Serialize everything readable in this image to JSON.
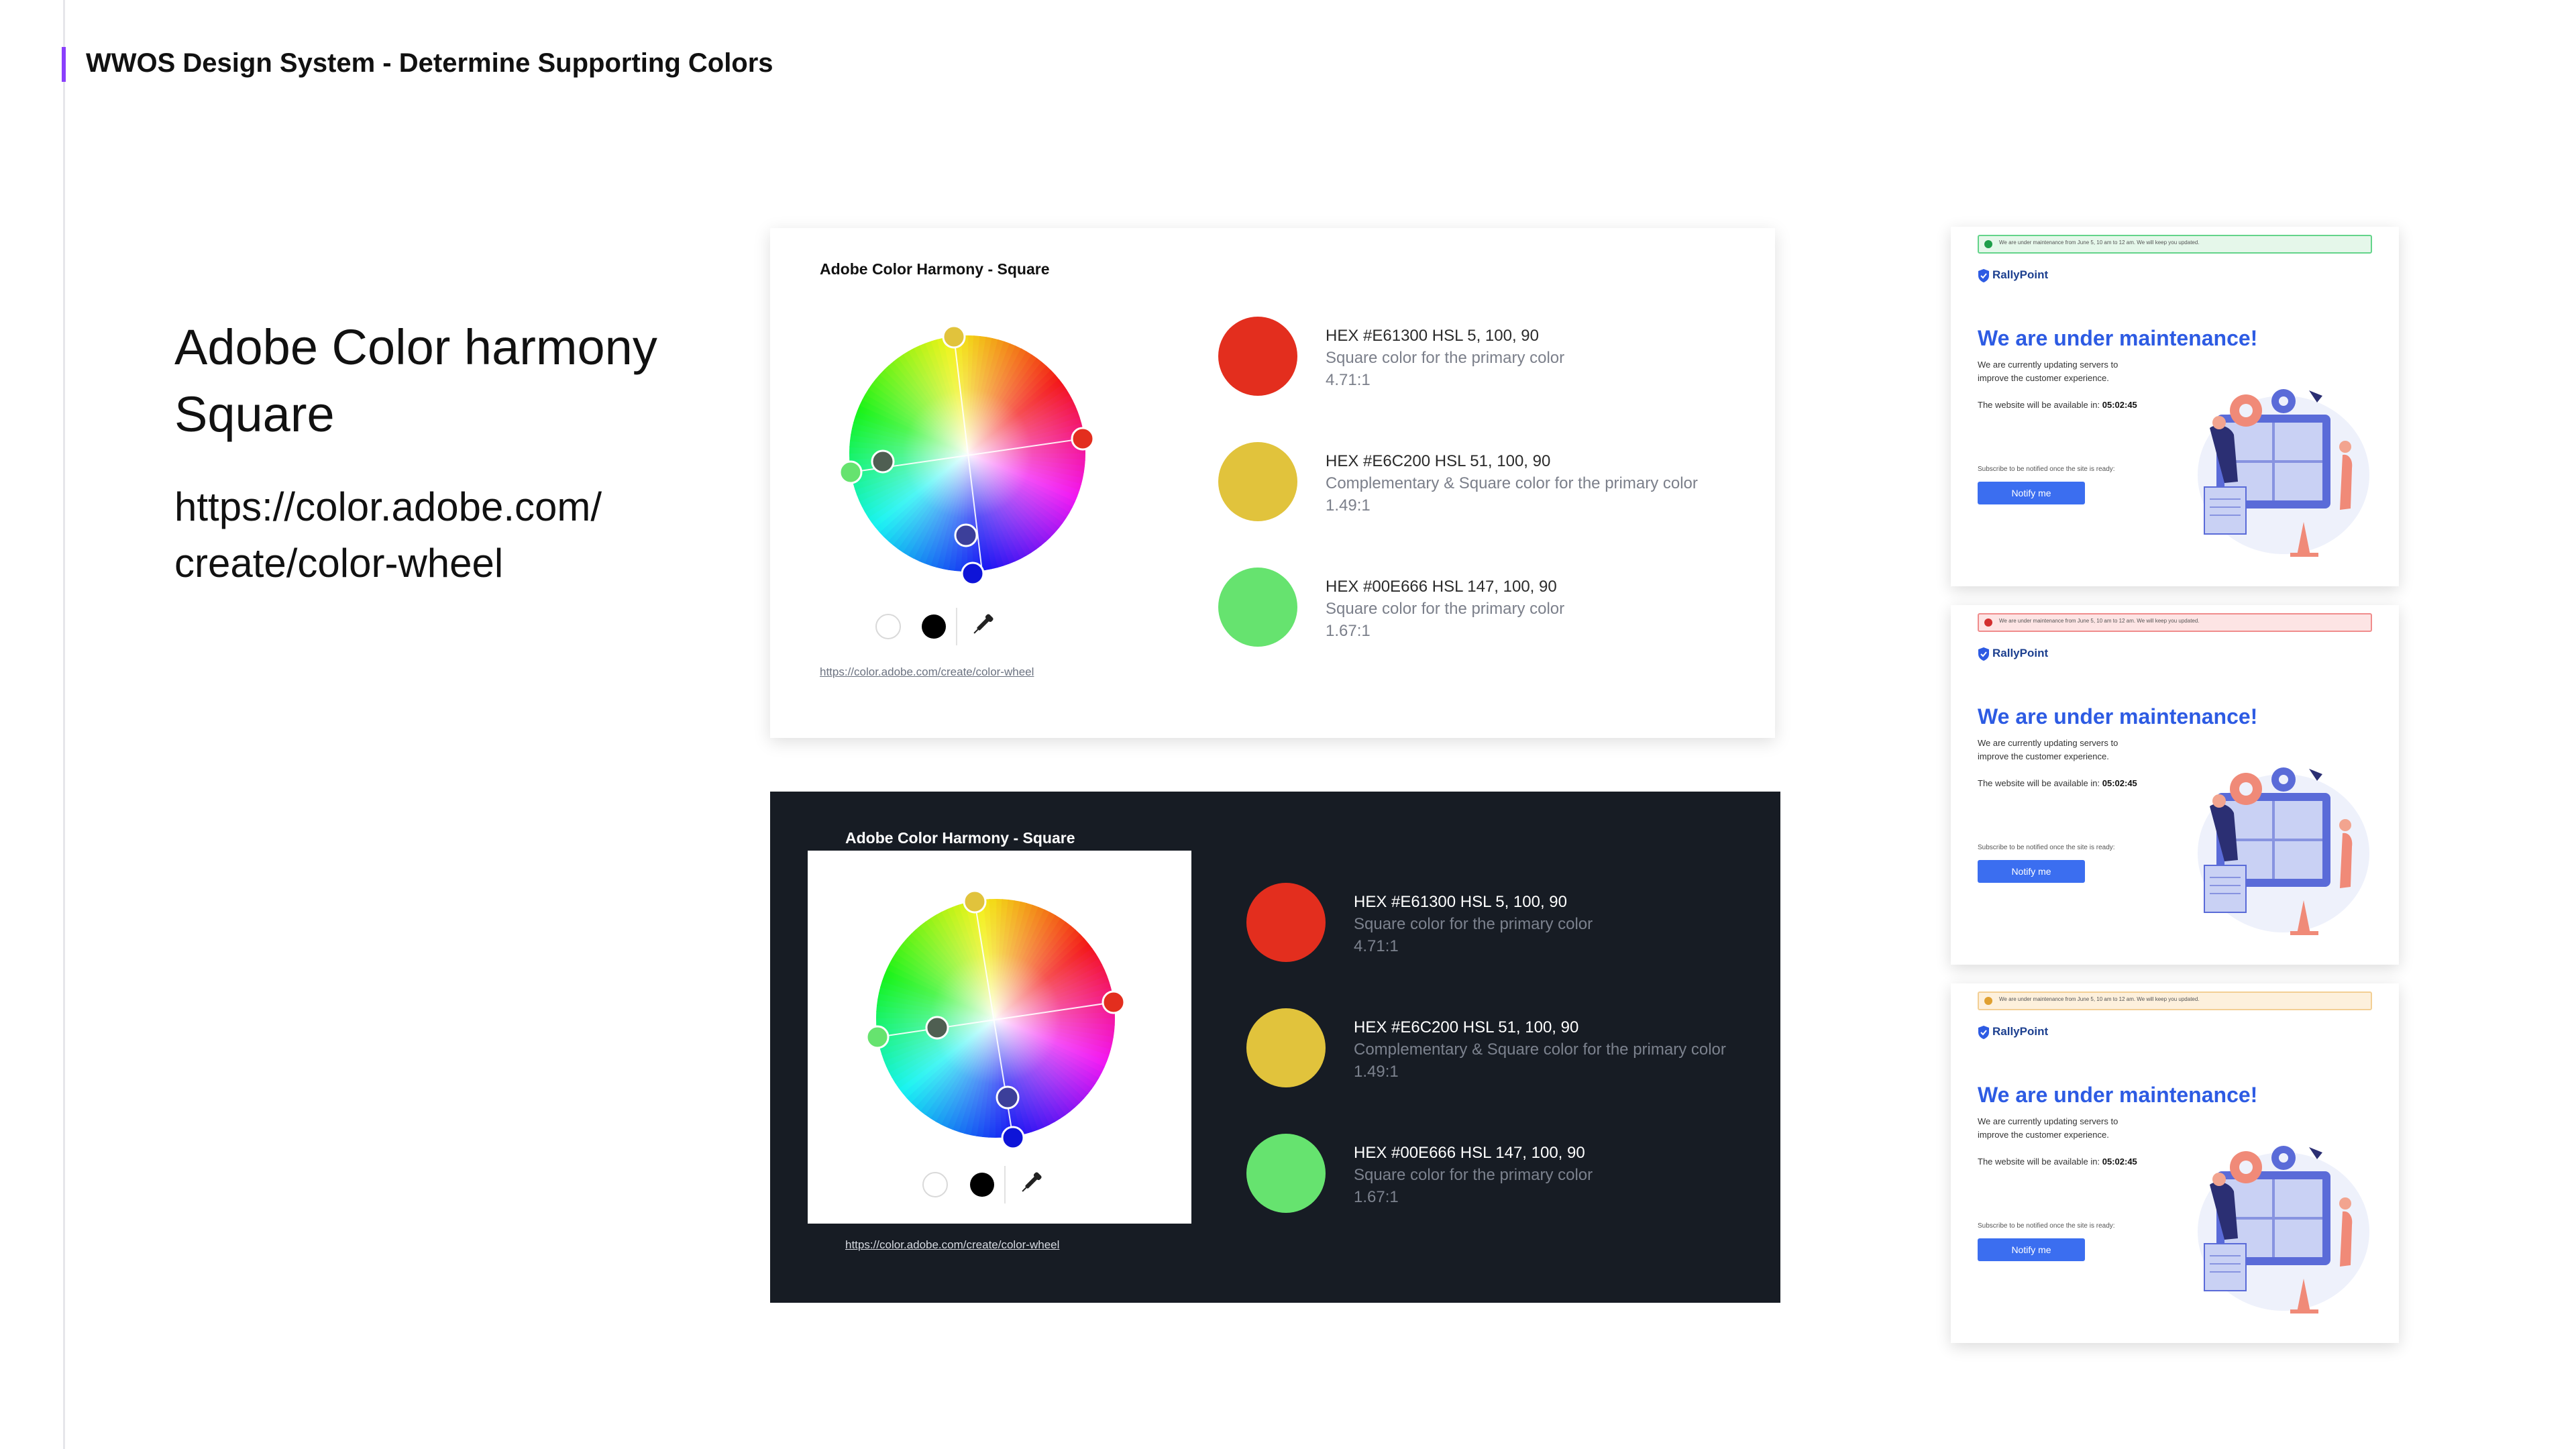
{
  "page": {
    "title": "WWOS Design System - Determine Supporting Colors"
  },
  "intro": {
    "heading_line1": "Adobe Color harmony",
    "heading_line2": "Square",
    "url_line1": "https://color.adobe.com/",
    "url_line2": "create/color-wheel"
  },
  "panels": [
    {
      "title": "Adobe Color Harmony - Square",
      "link": "https://color.adobe.com/create/color-wheel",
      "colors": [
        {
          "hex_line": "HEX #E61300 HSL 5, 100, 90",
          "role": "Square color for the primary color",
          "ratio": "4.71:1",
          "color": "#e32e1e"
        },
        {
          "hex_line": "HEX #E6C200 HSL 51, 100, 90",
          "role": "Complementary & Square color for the primary color",
          "ratio": "1.49:1",
          "color": "#e1c33c"
        },
        {
          "hex_line": "HEX #00E666 HSL 147, 100, 90",
          "role": "Square color for the primary color",
          "ratio": "1.67:1",
          "color": "#66e36f"
        }
      ]
    },
    {
      "title": "Adobe Color Harmony - Square",
      "link": "https://color.adobe.com/create/color-wheel",
      "colors": [
        {
          "hex_line": "HEX #E61300 HSL 5, 100, 90",
          "role": "Square color for the primary color",
          "ratio": "4.71:1",
          "color": "#e32e1e"
        },
        {
          "hex_line": "HEX #E6C200 HSL 51, 100, 90",
          "role": "Complementary & Square color for the primary color",
          "ratio": "1.49:1",
          "color": "#e1c33c"
        },
        {
          "hex_line": "HEX #00E666 HSL 147, 100, 90",
          "role": "Square color for the primary color",
          "ratio": "1.67:1",
          "color": "#66e36f"
        }
      ]
    }
  ],
  "wheel": {
    "handle_colors": [
      "#e1c33c",
      "#e32e1e",
      "#66e36f",
      "#3c3f9a",
      "#0e14d8",
      "#4a5a4a"
    ],
    "tools": [
      "white-swatch-icon",
      "black-swatch-icon",
      "eyedropper-icon"
    ]
  },
  "cards": [
    {
      "banner_text": "We are under maintenance from June 5, 10 am to 12 am. We will keep you updated.",
      "banner_bg": "#e5f7ea",
      "banner_border": "#63d48a",
      "banner_dot": "#1e9e4a",
      "brand": "RallyPoint",
      "heading": "We are under maintenance!",
      "body_line1": "We are currently updating servers to",
      "body_line2": "improve the customer experience.",
      "available_label": "The website will be available in:",
      "countdown": "05:02:45",
      "subscribe_text": "Subscribe to be notified once the site is ready:",
      "button_label": "Notify me"
    },
    {
      "banner_text": "We are under maintenance from June 5, 10 am to 12 am. We will keep you updated.",
      "banner_bg": "#fde4e4",
      "banner_border": "#f08c8c",
      "banner_dot": "#d32f2f",
      "brand": "RallyPoint",
      "heading": "We are under maintenance!",
      "body_line1": "We are currently updating servers to",
      "body_line2": "improve the customer experience.",
      "available_label": "The website will be available in:",
      "countdown": "05:02:45",
      "subscribe_text": "Subscribe to be notified once the site is ready:",
      "button_label": "Notify me"
    },
    {
      "banner_text": "We are under maintenance from June 5, 10 am to 12 am. We will keep you updated.",
      "banner_bg": "#fdf0dc",
      "banner_border": "#f3cf94",
      "banner_dot": "#e0a030",
      "brand": "RallyPoint",
      "heading": "We are under maintenance!",
      "body_line1": "We are currently updating servers to",
      "body_line2": "improve the customer experience.",
      "available_label": "The website will be available in:",
      "countdown": "05:02:45",
      "subscribe_text": "Subscribe to be notified once the site is ready:",
      "button_label": "Notify me"
    }
  ]
}
